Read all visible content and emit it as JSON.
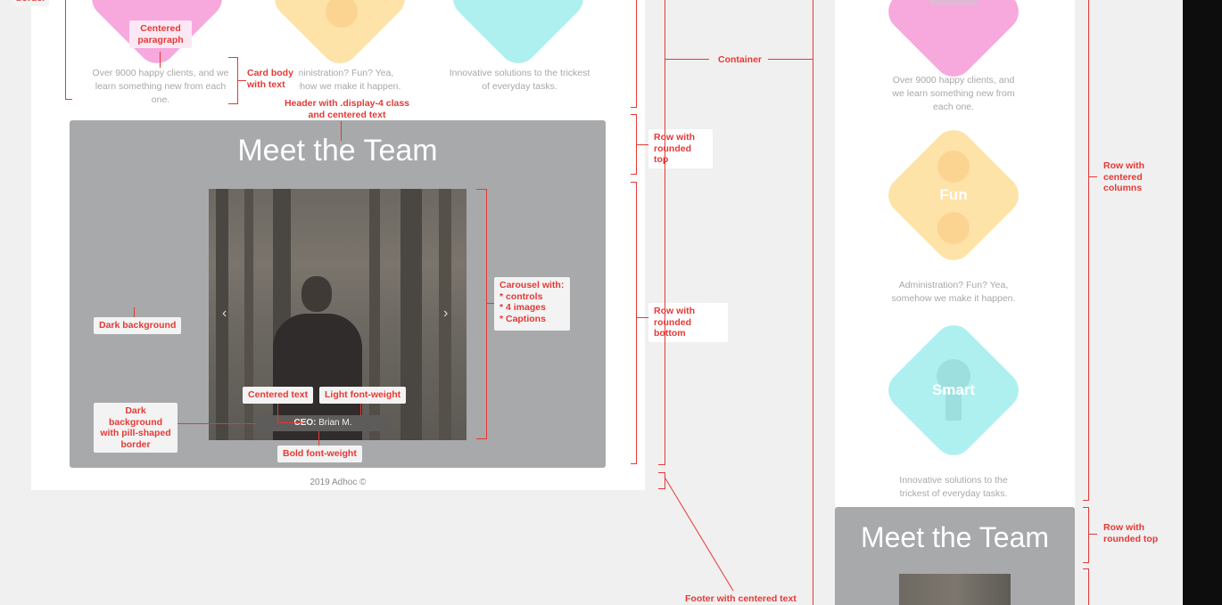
{
  "left_mock": {
    "cards": [
      {
        "text": "Over 9000 happy clients, and we learn something new from each one."
      },
      {
        "text": "Administration? Fun? Yea, somehow we make it happen."
      },
      {
        "text": "Innovative solutions to the trickest of everyday tasks."
      }
    ],
    "team_title": "Meet the Team",
    "caption_bold": "CEO:",
    "caption_text": "Brian M.",
    "footer": "2019 Adhoc ©"
  },
  "right_mock": {
    "cards": [
      {
        "label": "",
        "text": "Over 9000 happy clients, and we learn something new from each one."
      },
      {
        "label": "Fun",
        "text": "Administration? Fun? Yea, somehow we make it happen."
      },
      {
        "label": "Smart",
        "text": "Innovative solutions to the trickest of everyday tasks."
      }
    ],
    "team_title": "Meet the Team"
  },
  "annotations": {
    "centered_paragraph": "Centered paragraph",
    "card_body": "Card body with text",
    "header_display4": "Header with .display-4 class and centered text",
    "dark_background": "Dark background",
    "carousel": [
      "Carousel with:",
      "* controls",
      "* 4 images",
      "* Captions"
    ],
    "centered_text": "Centered text",
    "light_weight": "Light font-weight",
    "dark_pill": "Dark background with pill-shaped border",
    "bold_weight": "Bold font-weight",
    "container": "Container",
    "row_rounded_top": "Row with rounded top",
    "row_rounded_bottom": "Row with rounded bottom",
    "footer_centered": "Footer with centered text",
    "row_centered_columns": "Row with centered columns",
    "right_row_rounded_top": "Row with rounded top",
    "corner_cut": "border"
  },
  "colors": {
    "annotation": "#e53935",
    "pink": "#f7a8dd",
    "yellow": "#fde3a7",
    "cyan": "#aef0f0",
    "team_bg": "#a7a9ab"
  }
}
